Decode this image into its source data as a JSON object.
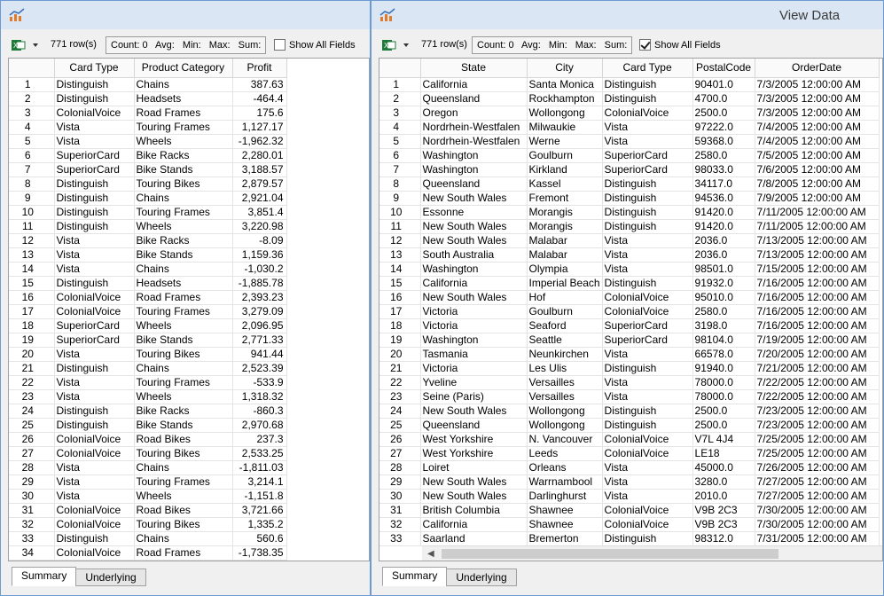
{
  "right_window": {
    "title": "View Data"
  },
  "colors": {
    "titlebar": "#dae6f4",
    "border": "#6d9bd1",
    "excel_green": "#1f7a3a"
  },
  "toolbar": {
    "row_count": "771 row(s)",
    "stats": {
      "count": "Count: 0",
      "avg": "Avg:",
      "min": "Min:",
      "max": "Max:",
      "sum": "Sum:"
    },
    "show_all_fields_label": "Show All Fields"
  },
  "tabs": [
    {
      "label": "Summary"
    },
    {
      "label": "Underlying"
    }
  ],
  "left_table": {
    "show_all_checked": false,
    "columns": [
      "Card Type",
      "Product Category",
      "Profit"
    ],
    "rows": [
      [
        "1",
        "Distinguish",
        "Chains",
        "387.63"
      ],
      [
        "2",
        "Distinguish",
        "Headsets",
        "-464.4"
      ],
      [
        "3",
        "ColonialVoice",
        "Road Frames",
        "175.6"
      ],
      [
        "4",
        "Vista",
        "Touring Frames",
        "1,127.17"
      ],
      [
        "5",
        "Vista",
        "Wheels",
        "-1,962.32"
      ],
      [
        "6",
        "SuperiorCard",
        "Bike Racks",
        "2,280.01"
      ],
      [
        "7",
        "SuperiorCard",
        "Bike Stands",
        "3,188.57"
      ],
      [
        "8",
        "Distinguish",
        "Touring Bikes",
        "2,879.57"
      ],
      [
        "9",
        "Distinguish",
        "Chains",
        "2,921.04"
      ],
      [
        "10",
        "Distinguish",
        "Touring Frames",
        "3,851.4"
      ],
      [
        "11",
        "Distinguish",
        "Wheels",
        "3,220.98"
      ],
      [
        "12",
        "Vista",
        "Bike Racks",
        "-8.09"
      ],
      [
        "13",
        "Vista",
        "Bike Stands",
        "1,159.36"
      ],
      [
        "14",
        "Vista",
        "Chains",
        "-1,030.2"
      ],
      [
        "15",
        "Distinguish",
        "Headsets",
        "-1,885.78"
      ],
      [
        "16",
        "ColonialVoice",
        "Road Frames",
        "2,393.23"
      ],
      [
        "17",
        "ColonialVoice",
        "Touring Frames",
        "3,279.09"
      ],
      [
        "18",
        "SuperiorCard",
        "Wheels",
        "2,096.95"
      ],
      [
        "19",
        "SuperiorCard",
        "Bike Stands",
        "2,771.33"
      ],
      [
        "20",
        "Vista",
        "Touring Bikes",
        "941.44"
      ],
      [
        "21",
        "Distinguish",
        "Chains",
        "2,523.39"
      ],
      [
        "22",
        "Vista",
        "Touring Frames",
        "-533.9"
      ],
      [
        "23",
        "Vista",
        "Wheels",
        "1,318.32"
      ],
      [
        "24",
        "Distinguish",
        "Bike Racks",
        "-860.3"
      ],
      [
        "25",
        "Distinguish",
        "Bike Stands",
        "2,970.68"
      ],
      [
        "26",
        "ColonialVoice",
        "Road Bikes",
        "237.3"
      ],
      [
        "27",
        "ColonialVoice",
        "Touring Bikes",
        "2,533.25"
      ],
      [
        "28",
        "Vista",
        "Chains",
        "-1,811.03"
      ],
      [
        "29",
        "Vista",
        "Touring Frames",
        "3,214.1"
      ],
      [
        "30",
        "Vista",
        "Wheels",
        "-1,151.8"
      ],
      [
        "31",
        "ColonialVoice",
        "Road Bikes",
        "3,721.66"
      ],
      [
        "32",
        "ColonialVoice",
        "Touring Bikes",
        "1,335.2"
      ],
      [
        "33",
        "Distinguish",
        "Chains",
        "560.6"
      ],
      [
        "34",
        "ColonialVoice",
        "Road Frames",
        "-1,738.35"
      ]
    ]
  },
  "right_table": {
    "show_all_checked": true,
    "columns": [
      "State",
      "City",
      "Card Type",
      "PostalCode",
      "OrderDate"
    ],
    "rows": [
      [
        "1",
        "California",
        "Santa Monica",
        "Distinguish",
        "90401.0",
        "7/3/2005 12:00:00 AM"
      ],
      [
        "2",
        "Queensland",
        "Rockhampton",
        "Distinguish",
        "4700.0",
        "7/3/2005 12:00:00 AM"
      ],
      [
        "3",
        "Oregon",
        "Wollongong",
        "ColonialVoice",
        "2500.0",
        "7/3/2005 12:00:00 AM"
      ],
      [
        "4",
        "Nordrhein-Westfalen",
        "Milwaukie",
        "Vista",
        "97222.0",
        "7/4/2005 12:00:00 AM"
      ],
      [
        "5",
        "Nordrhein-Westfalen",
        "Werne",
        "Vista",
        "59368.0",
        "7/4/2005 12:00:00 AM"
      ],
      [
        "6",
        "Washington",
        "Goulburn",
        "SuperiorCard",
        "2580.0",
        "7/5/2005 12:00:00 AM"
      ],
      [
        "7",
        "Washington",
        "Kirkland",
        "SuperiorCard",
        "98033.0",
        "7/6/2005 12:00:00 AM"
      ],
      [
        "8",
        "Queensland",
        "Kassel",
        "Distinguish",
        "34117.0",
        "7/8/2005 12:00:00 AM"
      ],
      [
        "9",
        "New South Wales",
        "Fremont",
        "Distinguish",
        "94536.0",
        "7/9/2005 12:00:00 AM"
      ],
      [
        "10",
        "Essonne",
        "Morangis",
        "Distinguish",
        "91420.0",
        "7/11/2005 12:00:00 AM"
      ],
      [
        "11",
        "New South Wales",
        "Morangis",
        "Distinguish",
        "91420.0",
        "7/11/2005 12:00:00 AM"
      ],
      [
        "12",
        "New South Wales",
        "Malabar",
        "Vista",
        "2036.0",
        "7/13/2005 12:00:00 AM"
      ],
      [
        "13",
        "South Australia",
        "Malabar",
        "Vista",
        "2036.0",
        "7/13/2005 12:00:00 AM"
      ],
      [
        "14",
        "Washington",
        "Olympia",
        "Vista",
        "98501.0",
        "7/15/2005 12:00:00 AM"
      ],
      [
        "15",
        "California",
        "Imperial Beach",
        "Distinguish",
        "91932.0",
        "7/16/2005 12:00:00 AM"
      ],
      [
        "16",
        "New South Wales",
        "Hof",
        "ColonialVoice",
        "95010.0",
        "7/16/2005 12:00:00 AM"
      ],
      [
        "17",
        "Victoria",
        "Goulburn",
        "ColonialVoice",
        "2580.0",
        "7/16/2005 12:00:00 AM"
      ],
      [
        "18",
        "Victoria",
        "Seaford",
        "SuperiorCard",
        "3198.0",
        "7/16/2005 12:00:00 AM"
      ],
      [
        "19",
        "Washington",
        "Seattle",
        "SuperiorCard",
        "98104.0",
        "7/19/2005 12:00:00 AM"
      ],
      [
        "20",
        "Tasmania",
        "Neunkirchen",
        "Vista",
        "66578.0",
        "7/20/2005 12:00:00 AM"
      ],
      [
        "21",
        "Victoria",
        "Les Ulis",
        "Distinguish",
        "91940.0",
        "7/21/2005 12:00:00 AM"
      ],
      [
        "22",
        "Yveline",
        "Versailles",
        "Vista",
        "78000.0",
        "7/22/2005 12:00:00 AM"
      ],
      [
        "23",
        "Seine (Paris)",
        "Versailles",
        "Vista",
        "78000.0",
        "7/22/2005 12:00:00 AM"
      ],
      [
        "24",
        "New South Wales",
        "Wollongong",
        "Distinguish",
        "2500.0",
        "7/23/2005 12:00:00 AM"
      ],
      [
        "25",
        "Queensland",
        "Wollongong",
        "Distinguish",
        "2500.0",
        "7/23/2005 12:00:00 AM"
      ],
      [
        "26",
        "West Yorkshire",
        "N. Vancouver",
        "ColonialVoice",
        "V7L 4J4",
        "7/25/2005 12:00:00 AM"
      ],
      [
        "27",
        "West Yorkshire",
        "Leeds",
        "ColonialVoice",
        "LE18",
        "7/25/2005 12:00:00 AM"
      ],
      [
        "28",
        "Loiret",
        "Orleans",
        "Vista",
        "45000.0",
        "7/26/2005 12:00:00 AM"
      ],
      [
        "29",
        "New South Wales",
        "Warrnambool",
        "Vista",
        "3280.0",
        "7/27/2005 12:00:00 AM"
      ],
      [
        "30",
        "New South Wales",
        "Darlinghurst",
        "Vista",
        "2010.0",
        "7/27/2005 12:00:00 AM"
      ],
      [
        "31",
        "British Columbia",
        "Shawnee",
        "ColonialVoice",
        "V9B 2C3",
        "7/30/2005 12:00:00 AM"
      ],
      [
        "32",
        "California",
        "Shawnee",
        "ColonialVoice",
        "V9B 2C3",
        "7/30/2005 12:00:00 AM"
      ],
      [
        "33",
        "Saarland",
        "Bremerton",
        "Distinguish",
        "98312.0",
        "7/31/2005 12:00:00 AM"
      ]
    ]
  }
}
